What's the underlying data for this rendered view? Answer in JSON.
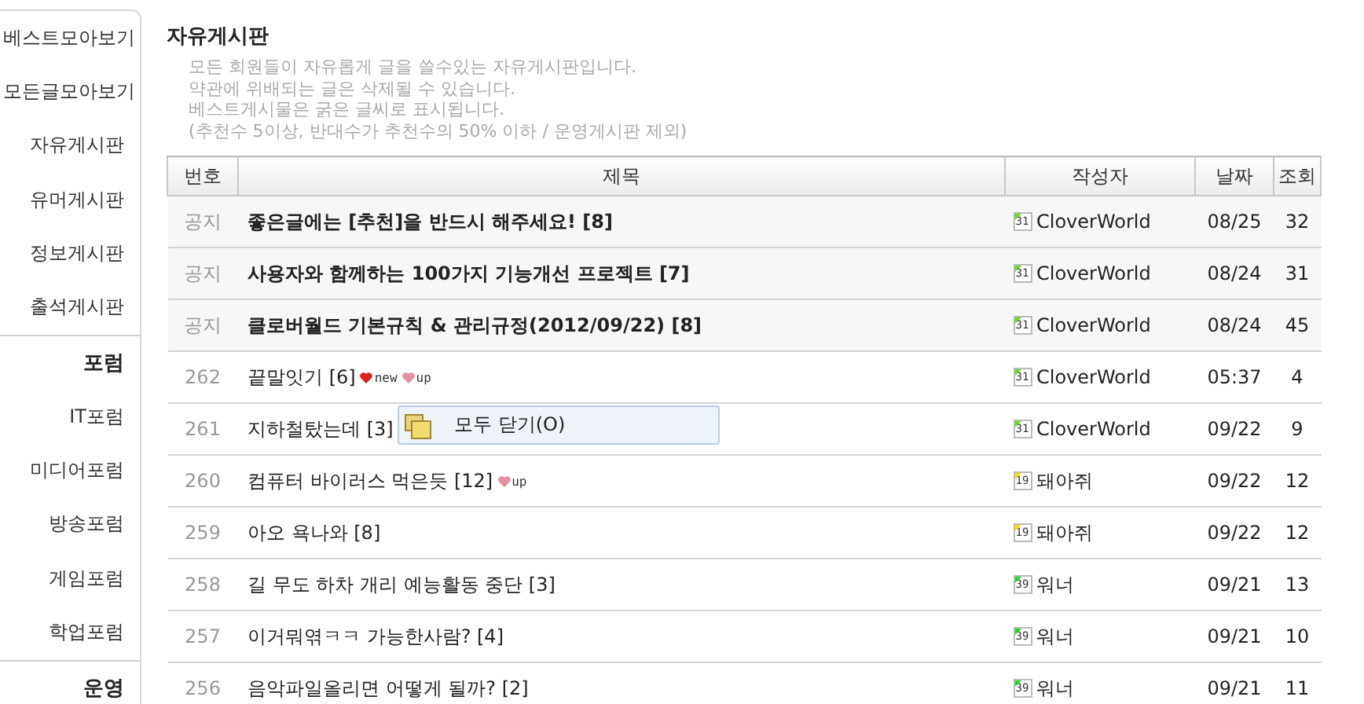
{
  "sidebar": {
    "items": [
      {
        "label": "베스트모아보기",
        "kind": "top"
      },
      {
        "label": "모든글모아보기",
        "kind": "top"
      },
      {
        "label": "자유게시판",
        "kind": "link"
      },
      {
        "label": "유머게시판",
        "kind": "link"
      },
      {
        "label": "정보게시판",
        "kind": "link"
      },
      {
        "label": "출석게시판",
        "kind": "link"
      },
      {
        "label": "포럼",
        "kind": "section"
      },
      {
        "label": "IT포럼",
        "kind": "link"
      },
      {
        "label": "미디어포럼",
        "kind": "link"
      },
      {
        "label": "방송포럼",
        "kind": "link"
      },
      {
        "label": "게임포럼",
        "kind": "link"
      },
      {
        "label": "학업포럼",
        "kind": "link"
      },
      {
        "label": "운영",
        "kind": "section"
      }
    ]
  },
  "board": {
    "title": "자유게시판",
    "description": [
      "모든 회원들이 자유롭게 글을 쓸수있는 자유게시판입니다.",
      "약관에 위배되는 글은 삭제될 수 있습니다.",
      "베스트게시물은 굵은 글씨로 표시됩니다.",
      "(추천수 5이상, 반대수가 추천수의 50% 이하 / 운영게시판 제외)"
    ]
  },
  "table": {
    "columns": [
      "번호",
      "제목",
      "작성자",
      "날짜",
      "조회"
    ],
    "rows": [
      {
        "kind": "notice",
        "number": "공지",
        "title": "좋은글에는 [추천]을 반드시 해주세요! [8]",
        "level": "31",
        "color": "#66dd22",
        "author": "CloverWorld",
        "date": "08/25",
        "views": "32"
      },
      {
        "kind": "notice",
        "number": "공지",
        "title": "사용자와 함께하는 100가지 기능개선 프로젝트 [7]",
        "level": "31",
        "color": "#66dd22",
        "author": "CloverWorld",
        "date": "08/24",
        "views": "31"
      },
      {
        "kind": "notice",
        "number": "공지",
        "title": "클로버월드 기본규칙 & 관리규정(2012/09/22) [8]",
        "level": "31",
        "color": "#66dd22",
        "author": "CloverWorld",
        "date": "08/24",
        "views": "45"
      },
      {
        "kind": "post",
        "number": "262",
        "title": "끝말잇기 [6]",
        "tags": [
          {
            "text": "new",
            "kind": "new"
          },
          {
            "text": "up",
            "kind": "up"
          }
        ],
        "level": "31",
        "color": "#66dd22",
        "author": "CloverWorld",
        "date": "05:37",
        "views": "4"
      },
      {
        "kind": "post",
        "number": "261",
        "title": "지하철탔는데 [3]",
        "level": "31",
        "color": "#66dd22",
        "author": "CloverWorld",
        "date": "09/22",
        "views": "9"
      },
      {
        "kind": "post",
        "number": "260",
        "title": "컴퓨터 바이러스 먹은듯 [12]",
        "tags": [
          {
            "text": "up",
            "kind": "up"
          }
        ],
        "level": "19",
        "color": "#ffdd00",
        "author": "돼아쥐",
        "date": "09/22",
        "views": "12"
      },
      {
        "kind": "post",
        "number": "259",
        "title": "아오 욕나와 [8]",
        "level": "19",
        "color": "#ffdd00",
        "author": "돼아쥐",
        "date": "09/22",
        "views": "12"
      },
      {
        "kind": "post",
        "number": "258",
        "title": "길 무도 하차 개리 예능활동 중단 [3]",
        "level": "39",
        "color": "#22dd22",
        "author": "워너",
        "date": "09/21",
        "views": "13"
      },
      {
        "kind": "post",
        "number": "257",
        "title": "이거뭐엮ㅋㅋ 가능한사람? [4]",
        "level": "39",
        "color": "#22dd22",
        "author": "워너",
        "date": "09/21",
        "views": "10"
      },
      {
        "kind": "post",
        "number": "256",
        "title": "음악파일올리면 어떻게 될까? [2]",
        "level": "39",
        "color": "#22dd22",
        "author": "워너",
        "date": "09/21",
        "views": "11"
      }
    ]
  },
  "context_menu": {
    "items": [
      {
        "label": "모두 닫기(O)"
      }
    ]
  }
}
